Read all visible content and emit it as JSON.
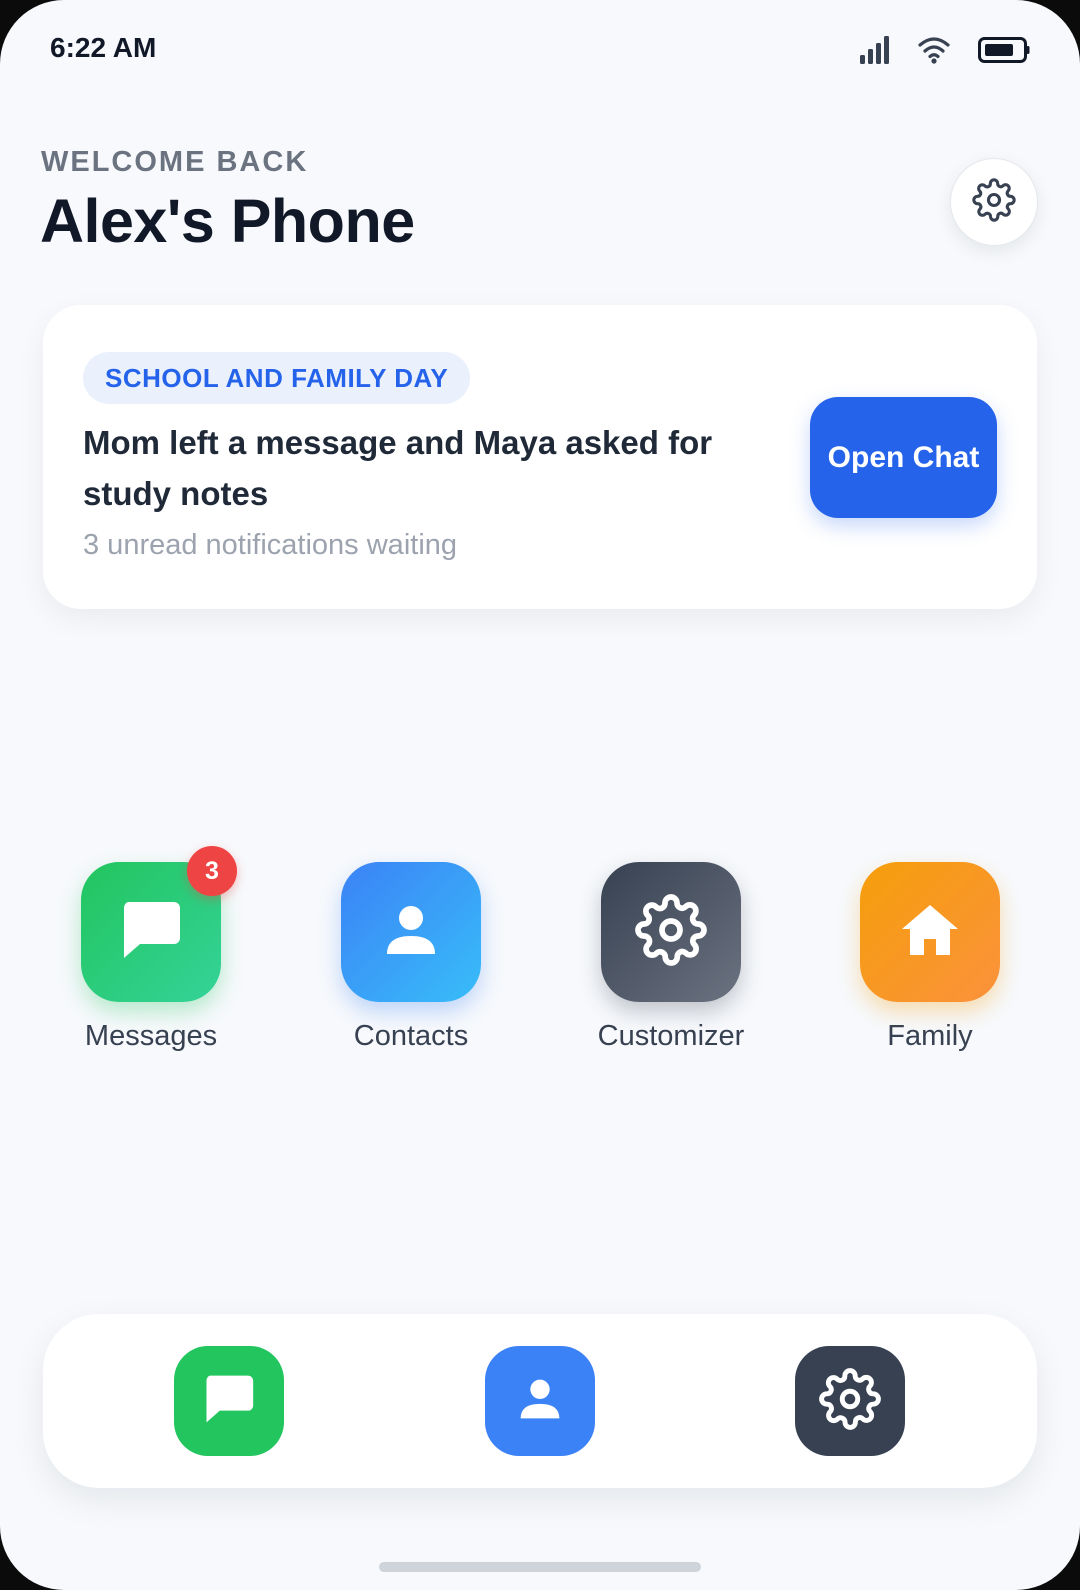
{
  "status_bar": {
    "time": "6:22 AM",
    "icons": [
      "signal-icon",
      "wifi-icon",
      "battery-icon"
    ]
  },
  "header": {
    "greeting": "WELCOME BACK",
    "title": "Alex's Phone",
    "settings_icon": "gear-icon"
  },
  "notification_card": {
    "tag": "SCHOOL AND FAMILY DAY",
    "message": "Mom left a message and Maya asked for study notes",
    "subtext": "3 unread notifications waiting",
    "action_label": "Open Chat"
  },
  "apps": [
    {
      "label": "Messages",
      "icon": "chat-bubble-icon",
      "badge": "3",
      "color": "#22c55e"
    },
    {
      "label": "Contacts",
      "icon": "person-icon",
      "color": "#3b82f6"
    },
    {
      "label": "Customizer",
      "icon": "gear-icon",
      "color": "#4b5563"
    },
    {
      "label": "Family",
      "icon": "house-icon",
      "color": "#f59e0b"
    }
  ],
  "dock": [
    {
      "icon": "chat-bubble-icon",
      "color": "#22c55e"
    },
    {
      "icon": "person-icon",
      "color": "#3b82f6"
    },
    {
      "icon": "gear-icon",
      "color": "#374151"
    }
  ],
  "colors": {
    "background": "#f7f9fc",
    "accent": "#2563eb",
    "badge": "#ef4444"
  }
}
